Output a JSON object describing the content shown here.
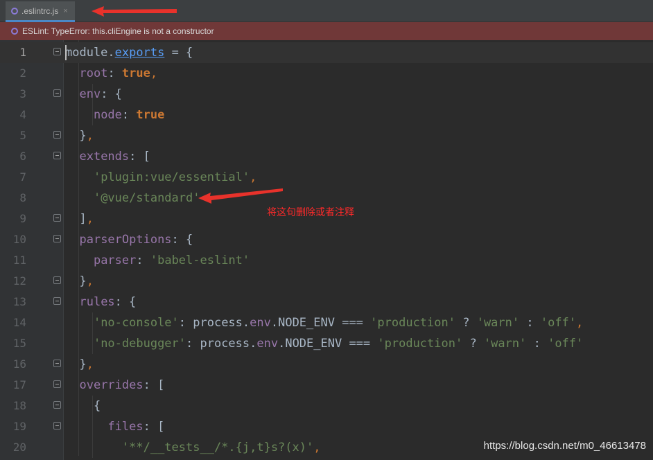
{
  "tab": {
    "label": ".eslintrc.js",
    "close": "×"
  },
  "warning": {
    "text": "ESLint: TypeError: this.cliEngine is not a constructor"
  },
  "editor": {
    "lines": [
      {
        "n": "1",
        "current": true,
        "fold": true
      },
      {
        "n": "2"
      },
      {
        "n": "3",
        "fold": true
      },
      {
        "n": "4"
      },
      {
        "n": "5",
        "fold": true
      },
      {
        "n": "6",
        "fold": true
      },
      {
        "n": "7"
      },
      {
        "n": "8"
      },
      {
        "n": "9",
        "fold": true
      },
      {
        "n": "10",
        "fold": true
      },
      {
        "n": "11"
      },
      {
        "n": "12",
        "fold": true
      },
      {
        "n": "13",
        "fold": true
      },
      {
        "n": "14"
      },
      {
        "n": "15"
      },
      {
        "n": "16",
        "fold": true
      },
      {
        "n": "17",
        "fold": true
      },
      {
        "n": "18",
        "fold": true
      },
      {
        "n": "19",
        "fold": true
      },
      {
        "n": "20"
      }
    ],
    "code": {
      "l1": {
        "a": "module",
        "b": ".",
        "c": "exports",
        "d": " = {"
      },
      "l2": {
        "a": "root",
        "b": ": ",
        "c": "true",
        "d": ","
      },
      "l3": {
        "a": "env",
        "b": ": {"
      },
      "l4": {
        "a": "node",
        "b": ": ",
        "c": "true"
      },
      "l5": {
        "a": "}",
        "b": ","
      },
      "l6": {
        "a": "extends",
        "b": ": ["
      },
      "l7": {
        "a": "'plugin:vue/essential'",
        "b": ","
      },
      "l8": {
        "a": "'@vue/standard'"
      },
      "l9": {
        "a": "]",
        "b": ","
      },
      "l10": {
        "a": "parserOptions",
        "b": ": {"
      },
      "l11": {
        "a": "parser",
        "b": ": ",
        "c": "'babel-eslint'"
      },
      "l12": {
        "a": "}",
        "b": ","
      },
      "l13": {
        "a": "rules",
        "b": ": {"
      },
      "l14": {
        "a": "'no-console'",
        "b": ": process.",
        "c": "env",
        "d": ".NODE_ENV === ",
        "e": "'production'",
        "f": " ? ",
        "g": "'warn'",
        "h": " : ",
        "i": "'off'",
        "j": ","
      },
      "l15": {
        "a": "'no-debugger'",
        "b": ": process.",
        "c": "env",
        "d": ".NODE_ENV === ",
        "e": "'production'",
        "f": " ? ",
        "g": "'warn'",
        "h": " : ",
        "i": "'off'"
      },
      "l16": {
        "a": "}",
        "b": ","
      },
      "l17": {
        "a": "overrides",
        "b": ": ["
      },
      "l18": {
        "a": "{"
      },
      "l19": {
        "a": "files",
        "b": ": ["
      },
      "l20": {
        "a": "'**/__tests__/*.{j,t}s?(x)'",
        "b": ","
      }
    }
  },
  "annotation": {
    "text": "将这句删除或者注释",
    "color": "#ff2a2a"
  },
  "watermark": {
    "text": "https://blog.csdn.net/m0_46613478"
  }
}
